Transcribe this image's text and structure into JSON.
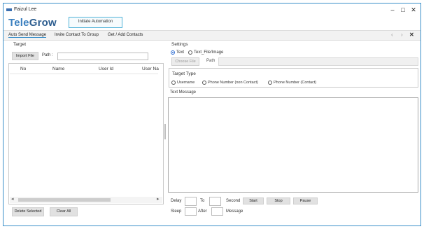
{
  "window": {
    "title": "Faizul Lee",
    "minimize": "–",
    "maximize": "□",
    "close": "✕"
  },
  "brand": {
    "logo_part1": "Tele",
    "logo_part2": "Grow",
    "automation_button": "Initiate Automation"
  },
  "tabs": [
    {
      "label": "Auto Send Message"
    },
    {
      "label": "Invite Contact To Group"
    },
    {
      "label": "Get / Add Contacts"
    }
  ],
  "nav": {
    "prev": "‹",
    "next": "›",
    "close": "✕"
  },
  "target": {
    "title": "Target",
    "import_button": "Import File",
    "path_label": "Path :",
    "path_value": "",
    "columns": [
      "No",
      "Name",
      "User Id",
      "User Name"
    ],
    "delete_button": "Delete Selected",
    "clear_button": "Clear All",
    "scroll_left": "◂",
    "scroll_right": "▸"
  },
  "settings": {
    "title": "Settings",
    "mode_text": "Text",
    "mode_file": "Text_File/Image",
    "mode_selected": "Text",
    "choose_file_button": "Choose File",
    "path_label": "Path",
    "path_value": "",
    "target_type_title": "Target Type",
    "target_types": [
      "Username",
      "Phone Number (non Contact)",
      "Phone Number (Contact)"
    ],
    "target_type_selected": "",
    "text_message_label": "Text Message",
    "text_message_value": ""
  },
  "controls": {
    "delay_label": "Delay",
    "to_label": "To",
    "second_label": "Second",
    "start_button": "Start",
    "stop_button": "Stop",
    "pause_button": "Pause",
    "sleep_label": "Sleep",
    "after_label": "After",
    "message_label": "Message",
    "delay_from": "",
    "delay_to": "",
    "sleep_value": "",
    "after_value": ""
  },
  "colors": {
    "accent": "#3a8fc9",
    "logo_blue": "#3a7fbf",
    "logo_dark": "#2c5d8f",
    "radio_selected": "#2a6bd1"
  }
}
